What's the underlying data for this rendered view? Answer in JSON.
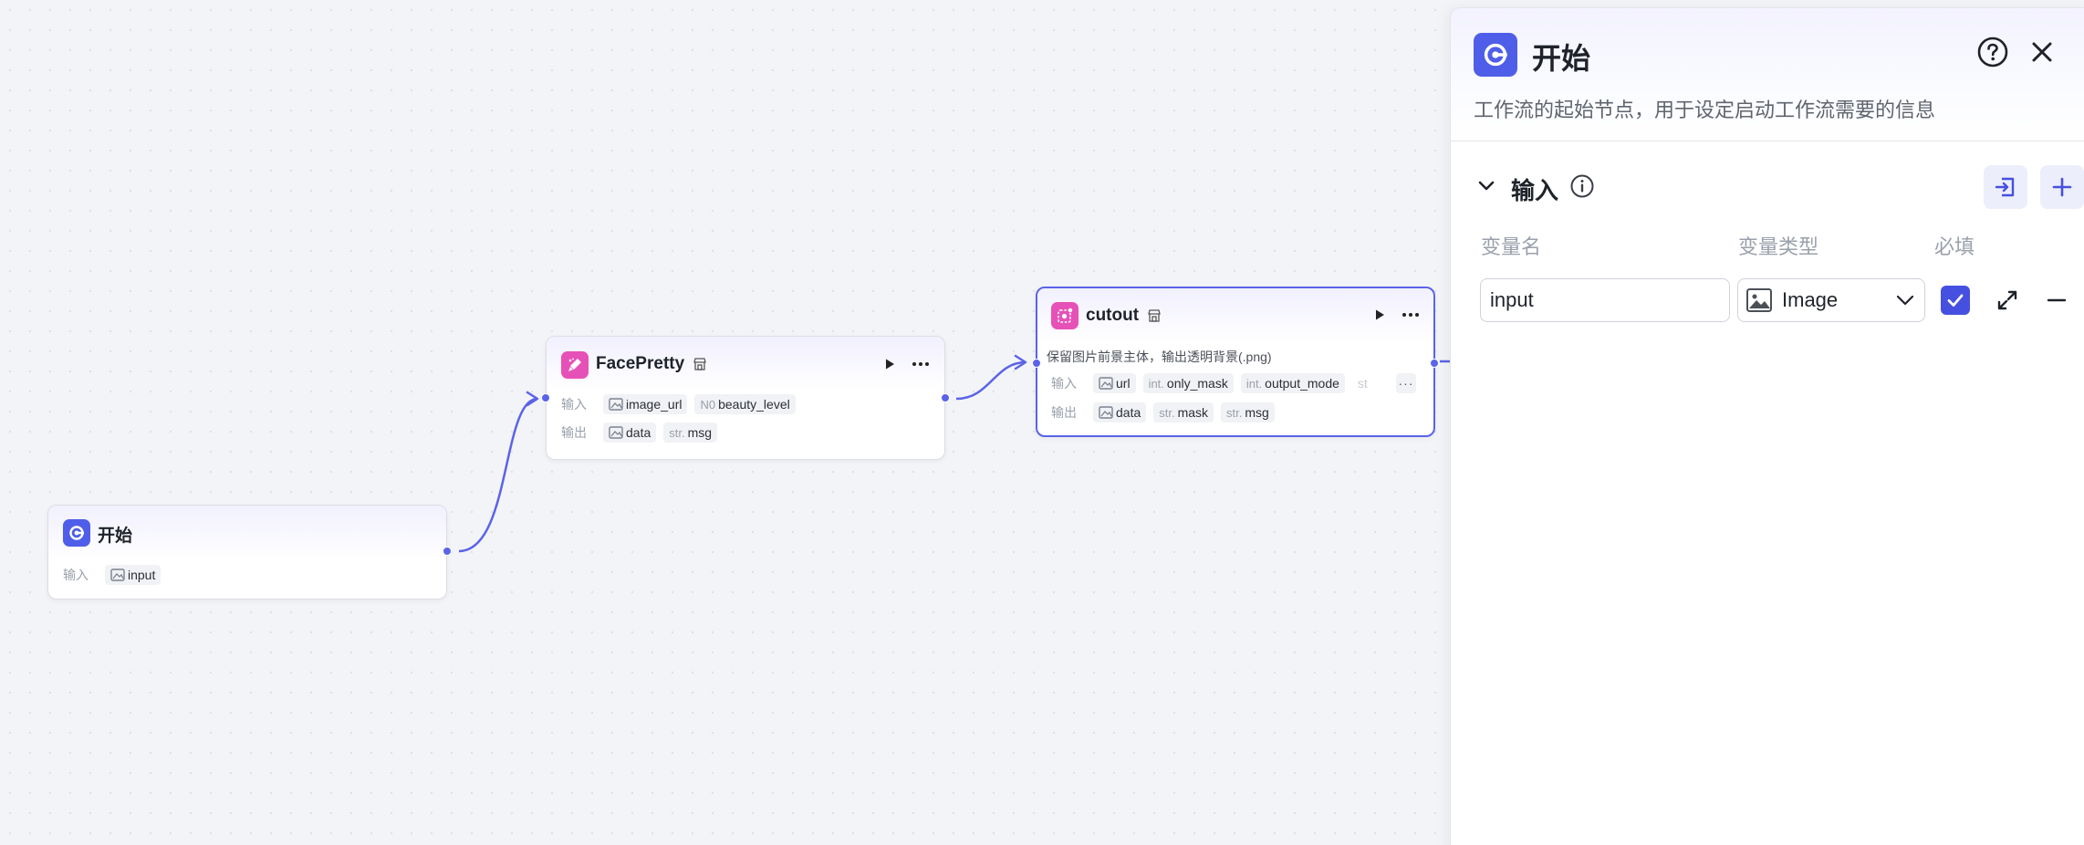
{
  "colors": {
    "accent": "#5b63e8",
    "start_icon": "#4f5ee8",
    "plugin_icon": "#e651b8"
  },
  "nodes": {
    "start": {
      "title": "开始",
      "icon": "start-icon",
      "input_label": "输入",
      "inputs": [
        {
          "type_icon": "image-icon",
          "name": "input"
        }
      ]
    },
    "facepretty": {
      "title": "FacePretty",
      "icon": "brush-icon",
      "input_label": "输入",
      "output_label": "输出",
      "inputs": [
        {
          "type_icon": "image-icon",
          "name": "image_url"
        },
        {
          "type": "N0",
          "name": "beauty_level"
        }
      ],
      "outputs": [
        {
          "type_icon": "image-icon",
          "name": "data"
        },
        {
          "type": "str.",
          "name": "msg"
        }
      ]
    },
    "cutout": {
      "title": "cutout",
      "icon": "cutout-icon",
      "description": "保留图片前景主体，输出透明背景(.png)",
      "input_label": "输入",
      "output_label": "输出",
      "inputs": [
        {
          "type_icon": "image-icon",
          "name": "url"
        },
        {
          "type": "int.",
          "name": "only_mask"
        },
        {
          "type": "int.",
          "name": "output_mode"
        },
        {
          "type": "st"
        }
      ],
      "more_label": "···",
      "outputs": [
        {
          "type_icon": "image-icon",
          "name": "data"
        },
        {
          "type": "str.",
          "name": "mask"
        },
        {
          "type": "str.",
          "name": "msg"
        }
      ]
    }
  },
  "panel": {
    "title": "开始",
    "description": "工作流的起始节点，用于设定启动工作流需要的信息",
    "section": {
      "title": "输入",
      "columns": {
        "name": "变量名",
        "type": "变量类型",
        "required": "必填"
      },
      "variables": [
        {
          "name": "input",
          "type": "Image",
          "required": true
        }
      ]
    }
  }
}
